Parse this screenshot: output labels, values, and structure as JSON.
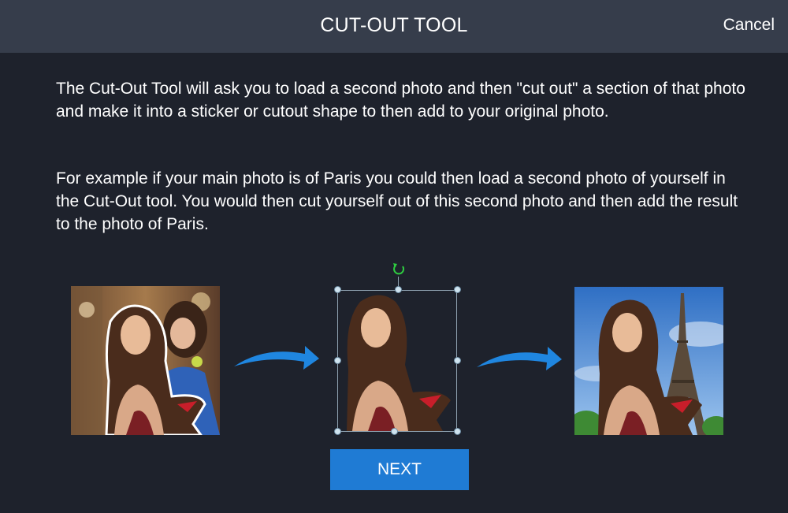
{
  "header": {
    "title": "CUT-OUT TOOL",
    "cancel_label": "Cancel"
  },
  "intro": {
    "paragraph_1": "The Cut-Out Tool will ask you to load a second photo and then \"cut out\" a section of that photo and make it into a sticker or cutout shape to then add to your original photo.",
    "paragraph_2": "For example if your main photo is of Paris you could then load a second photo of yourself in the Cut-Out tool. You would then cut yourself out of this second photo and then add the result to the photo of Paris."
  },
  "illustration": {
    "steps": [
      "original-photo",
      "cutout-selection",
      "result-on-paris"
    ],
    "colors": {
      "arrow": "#1f86e0",
      "rotate_handle": "#2ecc40",
      "selection_handle": "#cfe3ef",
      "sky": "#4a90d9"
    }
  },
  "footer": {
    "next_label": "NEXT",
    "next_color": "#1f7bd4"
  }
}
